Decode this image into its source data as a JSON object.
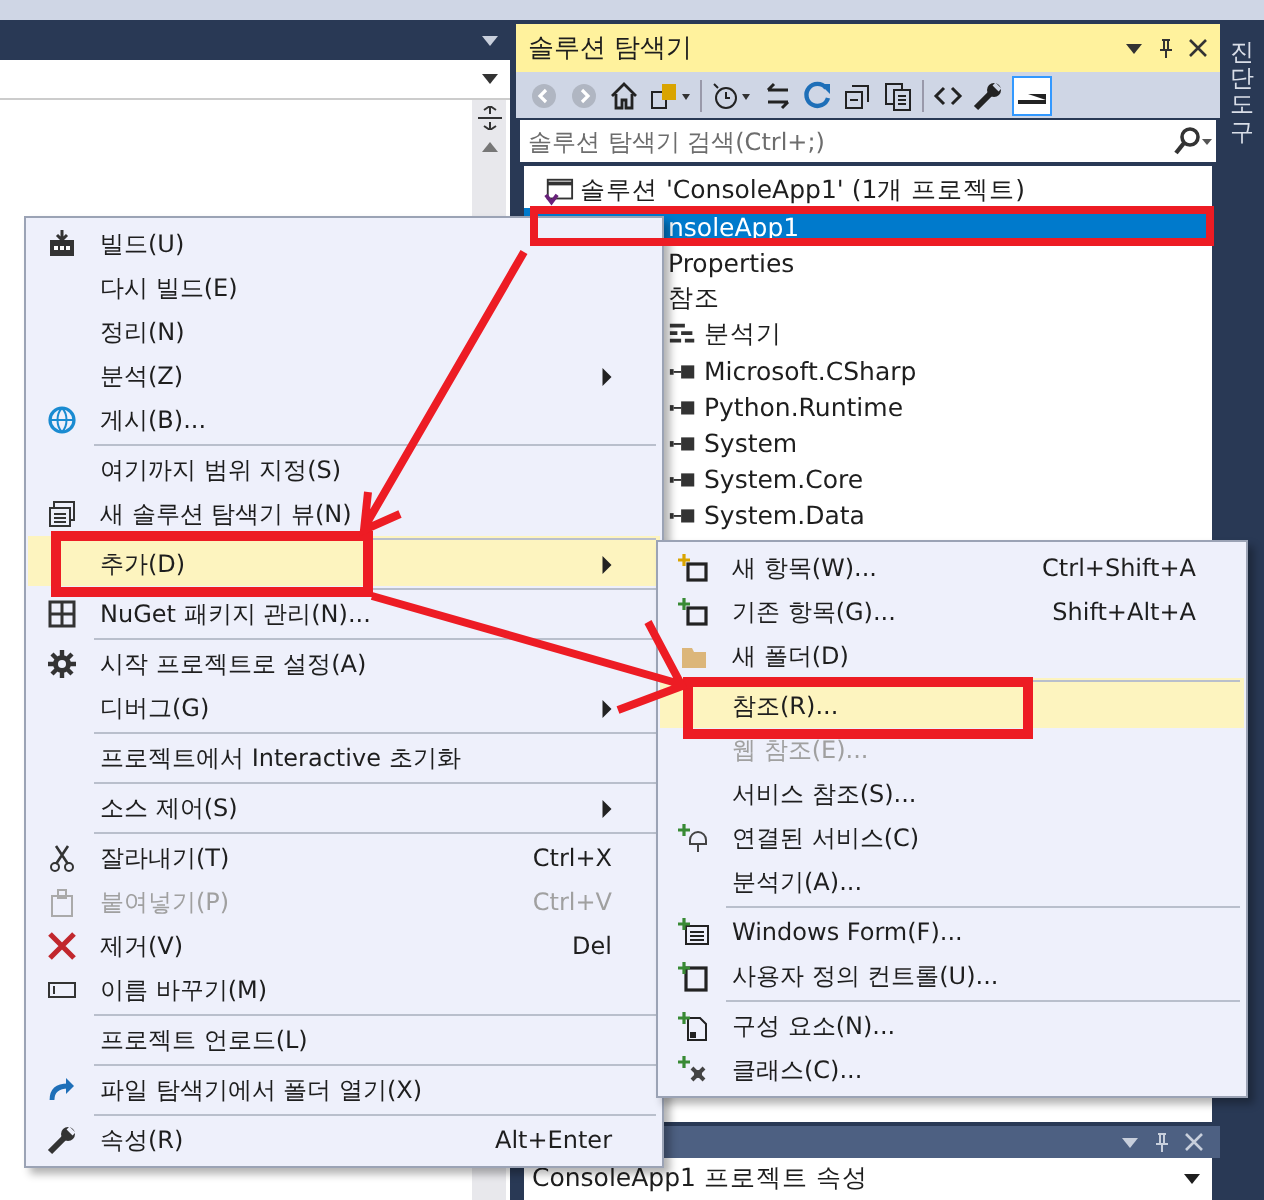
{
  "solution_explorer": {
    "title": "솔루션 탐색기",
    "search": {
      "placeholder": "솔루션 탐색기 검색(Ctrl+;)"
    },
    "tree": [
      {
        "label": "솔루션 'ConsoleApp1' (1개 프로젝트)",
        "selected": false,
        "children": [
          {
            "label": "nsoleApp1",
            "selected": true,
            "children": [
              {
                "label": "Properties",
                "selected": false
              },
              {
                "label": "참조",
                "selected": false,
                "children": [
                  {
                    "label": "분석기",
                    "selected": false,
                    "kind": "analyzer"
                  },
                  {
                    "label": "Microsoft.CSharp",
                    "selected": false,
                    "kind": "assembly"
                  },
                  {
                    "label": "Python.Runtime",
                    "selected": false,
                    "kind": "assembly"
                  },
                  {
                    "label": "System",
                    "selected": false,
                    "kind": "assembly"
                  },
                  {
                    "label": "System.Core",
                    "selected": false,
                    "kind": "assembly"
                  },
                  {
                    "label": "System.Data",
                    "selected": false,
                    "kind": "assembly"
                  }
                ]
              }
            ]
          }
        ]
      }
    ]
  },
  "side_tab": {
    "label": "진단 도구"
  },
  "context_menu": {
    "items": [
      {
        "label": "빌드(U)",
        "submenu": false,
        "disabled": false,
        "selected": false,
        "separator_before": false
      },
      {
        "label": "다시 빌드(E)",
        "submenu": false,
        "disabled": false,
        "selected": false,
        "separator_before": false
      },
      {
        "label": "정리(N)",
        "submenu": false,
        "disabled": false,
        "selected": false,
        "separator_before": false
      },
      {
        "label": "분석(Z)",
        "submenu": true,
        "disabled": false,
        "selected": false,
        "separator_before": false
      },
      {
        "label": "게시(B)...",
        "submenu": false,
        "disabled": false,
        "selected": false,
        "separator_before": false
      },
      {
        "label": "여기까지 범위 지정(S)",
        "submenu": false,
        "disabled": false,
        "selected": false,
        "separator_before": true
      },
      {
        "label": "새 솔루션 탐색기 뷰(N)",
        "submenu": false,
        "disabled": false,
        "selected": false,
        "separator_before": false
      },
      {
        "label": "추가(D)",
        "submenu": true,
        "disabled": false,
        "selected": true,
        "separator_before": true
      },
      {
        "label": "NuGet 패키지 관리(N)...",
        "submenu": false,
        "disabled": false,
        "selected": false,
        "separator_before": true
      },
      {
        "label": "시작 프로젝트로 설정(A)",
        "submenu": false,
        "disabled": false,
        "selected": false,
        "separator_before": true
      },
      {
        "label": "디버그(G)",
        "submenu": true,
        "disabled": false,
        "selected": false,
        "separator_before": false
      },
      {
        "label": "프로젝트에서 Interactive 초기화",
        "submenu": false,
        "disabled": false,
        "selected": false,
        "separator_before": true
      },
      {
        "label": "소스 제어(S)",
        "submenu": true,
        "disabled": false,
        "selected": false,
        "separator_before": true
      },
      {
        "label": "잘라내기(T)",
        "shortcut": "Ctrl+X",
        "submenu": false,
        "disabled": false,
        "selected": false,
        "separator_before": true
      },
      {
        "label": "붙여넣기(P)",
        "shortcut": "Ctrl+V",
        "submenu": false,
        "disabled": true,
        "selected": false,
        "separator_before": false
      },
      {
        "label": "제거(V)",
        "shortcut": "Del",
        "submenu": false,
        "disabled": false,
        "selected": false,
        "separator_before": false
      },
      {
        "label": "이름 바꾸기(M)",
        "submenu": false,
        "disabled": false,
        "selected": false,
        "separator_before": false
      },
      {
        "label": "프로젝트 언로드(L)",
        "submenu": false,
        "disabled": false,
        "selected": false,
        "separator_before": true
      },
      {
        "label": "파일 탐색기에서 폴더 열기(X)",
        "submenu": false,
        "disabled": false,
        "selected": false,
        "separator_before": true
      },
      {
        "label": "속성(R)",
        "shortcut": "Alt+Enter",
        "submenu": false,
        "disabled": false,
        "selected": false,
        "separator_before": true
      }
    ]
  },
  "add_submenu": {
    "items": [
      {
        "label": "새 항목(W)...",
        "shortcut": "Ctrl+Shift+A",
        "disabled": false,
        "selected": false,
        "separator_before": false
      },
      {
        "label": "기존 항목(G)...",
        "shortcut": "Shift+Alt+A",
        "disabled": false,
        "selected": false,
        "separator_before": false
      },
      {
        "label": "새 폴더(D)",
        "disabled": false,
        "selected": false,
        "separator_before": false
      },
      {
        "label": "참조(R)...",
        "disabled": false,
        "selected": true,
        "separator_before": true
      },
      {
        "label": "웹 참조(E)...",
        "disabled": true,
        "selected": false,
        "separator_before": false
      },
      {
        "label": "서비스 참조(S)...",
        "disabled": false,
        "selected": false,
        "separator_before": false
      },
      {
        "label": "연결된 서비스(C)",
        "disabled": false,
        "selected": false,
        "separator_before": false
      },
      {
        "label": "분석기(A)...",
        "disabled": false,
        "selected": false,
        "separator_before": false
      },
      {
        "label": "Windows Form(F)...",
        "disabled": false,
        "selected": false,
        "separator_before": true
      },
      {
        "label": "사용자 정의 컨트롤(U)...",
        "disabled": false,
        "selected": false,
        "separator_before": false
      },
      {
        "label": "구성 요소(N)...",
        "disabled": false,
        "selected": false,
        "separator_before": true
      },
      {
        "label": "클래스(C)...",
        "disabled": false,
        "selected": false,
        "separator_before": false
      }
    ]
  },
  "properties": {
    "dropdown": "ConsoleApp1 프로젝트 속성"
  }
}
